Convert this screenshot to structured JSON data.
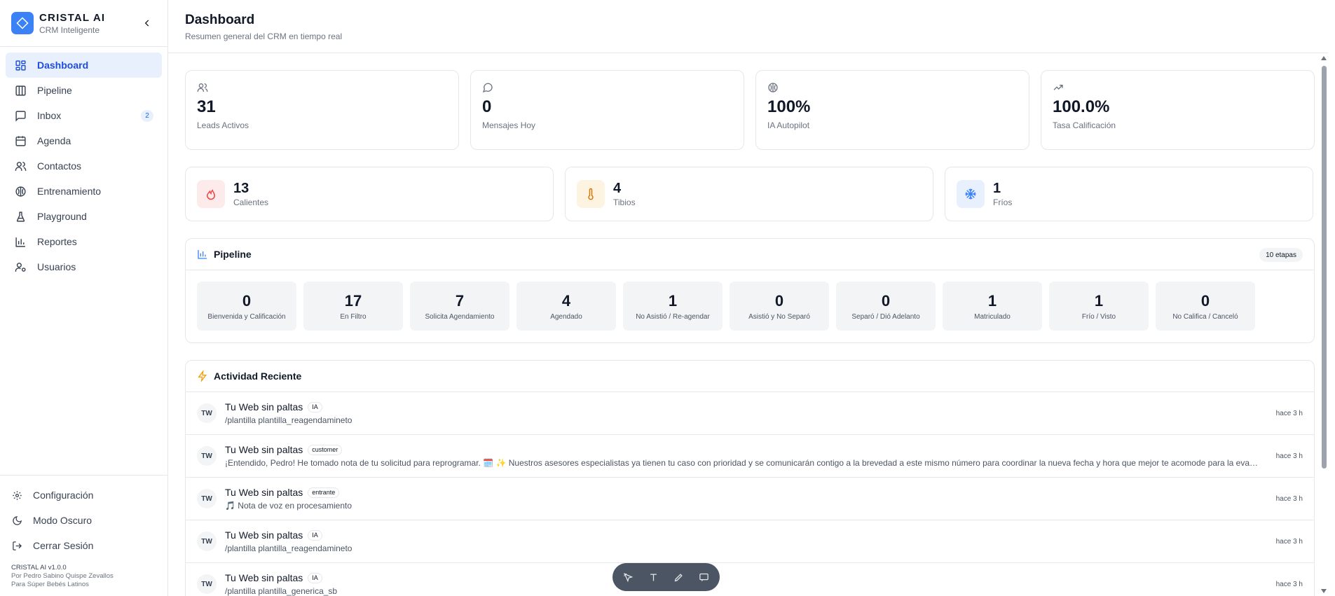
{
  "brand": {
    "name": "CRISTAL AI",
    "subtitle": "CRM Inteligente",
    "color": "#3b82f6"
  },
  "sidebar": {
    "items": [
      {
        "label": "Dashboard",
        "icon": "grid-icon",
        "active": true
      },
      {
        "label": "Pipeline",
        "icon": "columns-icon"
      },
      {
        "label": "Inbox",
        "icon": "message-icon",
        "badge": "2"
      },
      {
        "label": "Agenda",
        "icon": "calendar-icon"
      },
      {
        "label": "Contactos",
        "icon": "users-icon"
      },
      {
        "label": "Entrenamiento",
        "icon": "brain-icon"
      },
      {
        "label": "Playground",
        "icon": "flask-icon"
      },
      {
        "label": "Reportes",
        "icon": "bar-chart-icon"
      },
      {
        "label": "Usuarios",
        "icon": "user-cog-icon"
      }
    ],
    "bottom": [
      {
        "label": "Configuración",
        "icon": "gear-icon"
      },
      {
        "label": "Modo Oscuro",
        "icon": "moon-icon"
      },
      {
        "label": "Cerrar Sesión",
        "icon": "logout-icon"
      }
    ],
    "version": "CRISTAL AI v1.0.0",
    "credit_1": "Por Pedro Sabino Quispe Zevallos",
    "credit_2": "Para Súper Bebés Latinos"
  },
  "header": {
    "title": "Dashboard",
    "subtitle": "Resumen general del CRM en tiempo real"
  },
  "stats": [
    {
      "value": "31",
      "label": "Leads Activos",
      "icon": "users-icon"
    },
    {
      "value": "0",
      "label": "Mensajes Hoy",
      "icon": "message-icon"
    },
    {
      "value": "100%",
      "label": "IA Autopilot",
      "icon": "brain-icon"
    },
    {
      "value": "100.0%",
      "label": "Tasa Calificación",
      "icon": "trending-up-icon"
    }
  ],
  "temperature": [
    {
      "value": "13",
      "label": "Calientes",
      "icon": "flame-icon",
      "color": "#ef4444",
      "bg": "#fdeaea"
    },
    {
      "value": "4",
      "label": "Tibios",
      "icon": "thermometer-icon",
      "color": "#d97706",
      "bg": "#fdf3e1"
    },
    {
      "value": "1",
      "label": "Fríos",
      "icon": "snowflake-icon",
      "color": "#3b82f6",
      "bg": "#e8f0fe"
    }
  ],
  "pipeline": {
    "title": "Pipeline",
    "badge": "10 etapas",
    "stages": [
      {
        "count": "0",
        "name": "Bienvenida y Calificación"
      },
      {
        "count": "17",
        "name": "En Filtro"
      },
      {
        "count": "7",
        "name": "Solicita Agendamiento"
      },
      {
        "count": "4",
        "name": "Agendado"
      },
      {
        "count": "1",
        "name": "No Asistió / Re-agendar"
      },
      {
        "count": "0",
        "name": "Asistió y No Separó"
      },
      {
        "count": "0",
        "name": "Separó / Dió Adelanto"
      },
      {
        "count": "1",
        "name": "Matriculado"
      },
      {
        "count": "1",
        "name": "Frío / Visto"
      },
      {
        "count": "0",
        "name": "No Califica / Canceló"
      }
    ]
  },
  "activity": {
    "title": "Actividad Reciente",
    "items": [
      {
        "initials": "TW",
        "name": "Tu Web sin paltas",
        "tag": "IA",
        "message": "/plantilla plantilla_reagendamineto",
        "time": "hace 3 h"
      },
      {
        "initials": "TW",
        "name": "Tu Web sin paltas",
        "tag": "customer",
        "message": "¡Entendido, Pedro! He tomado nota de tu solicitud para reprogramar. 🗓️ ✨ Nuestros asesores especialistas ya tienen tu caso con prioridad y se comunicarán contigo a la brevedad a este mismo número para coordinar la nueva fecha y hora que mejor te acomode para la evaluación...",
        "time": "hace 3 h"
      },
      {
        "initials": "TW",
        "name": "Tu Web sin paltas",
        "tag": "entrante",
        "message": "🎵 Nota de voz en procesamiento",
        "time": "hace 3 h"
      },
      {
        "initials": "TW",
        "name": "Tu Web sin paltas",
        "tag": "IA",
        "message": "/plantilla plantilla_reagendamineto",
        "time": "hace 3 h"
      },
      {
        "initials": "TW",
        "name": "Tu Web sin paltas",
        "tag": "IA",
        "message": "/plantilla plantilla_generica_sb",
        "time": "hace 3 h"
      }
    ]
  }
}
